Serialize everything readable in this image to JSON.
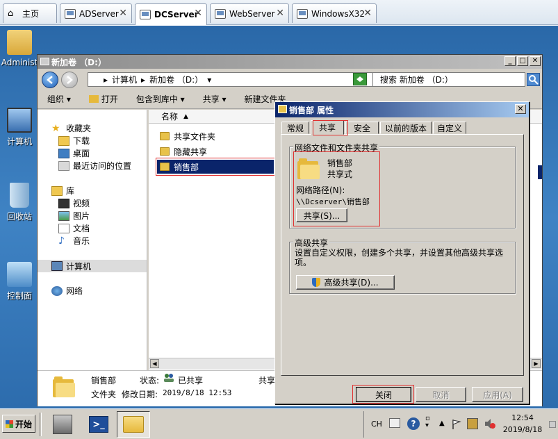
{
  "vm_tabs": [
    {
      "label": "主页",
      "icon": "home-icon"
    },
    {
      "label": "ADServer",
      "icon": "vm-icon"
    },
    {
      "label": "DCServer",
      "icon": "vm-icon",
      "active": true
    },
    {
      "label": "WebServer",
      "icon": "vm-icon"
    },
    {
      "label": "WindowsX32",
      "icon": "vm-icon"
    }
  ],
  "desktop_icons": [
    {
      "label": "Administ"
    },
    {
      "label": "计算机"
    },
    {
      "label": "回收站"
    },
    {
      "label": "控制面"
    }
  ],
  "explorer": {
    "title": "新加卷 （D:）",
    "address": {
      "crumb1": "计算机",
      "crumb2": "新加卷 （D:）"
    },
    "search_placeholder": "搜索 新加卷 （D:）",
    "commands": {
      "organize": "组织 ▾",
      "open": "打开",
      "include_library": "包含到库中 ▾",
      "share": "共享 ▾",
      "new_folder": "新建文件夹"
    },
    "nav": {
      "favorites": "收藏夹",
      "downloads": "下载",
      "desktop": "桌面",
      "recent": "最近访问的位置",
      "libraries": "库",
      "videos": "视频",
      "pictures": "图片",
      "documents": "文档",
      "music": "音乐",
      "computer": "计算机",
      "network": "网络"
    },
    "column_name": "名称",
    "files": [
      {
        "name": "共享文件夹"
      },
      {
        "name": "隐藏共享"
      },
      {
        "name": "销售部",
        "selected": true
      }
    ],
    "details": {
      "name": "销售部",
      "type": "文件夹",
      "status_label": "状态:",
      "status_value": "已共享",
      "modified_label": "修改日期:",
      "modified_value": "2019/8/18 12:53",
      "share_label": "共享"
    }
  },
  "dialog": {
    "title": "销售部 属性",
    "tabs": [
      {
        "label": "常规"
      },
      {
        "label": "共享",
        "active": true
      },
      {
        "label": "安全"
      },
      {
        "label": "以前的版本"
      },
      {
        "label": "自定义"
      }
    ],
    "network_share": {
      "group_label": "网络文件和文件夹共享",
      "folder_name": "销售部",
      "folder_state": "共享式",
      "path_label": "网络路径(N):",
      "path_value": "\\\\Dcserver\\销售部",
      "share_button": "共享(S)..."
    },
    "advanced_share": {
      "group_label": "高级共享",
      "description": "设置自定义权限，创建多个共享，并设置其他高级共享选项。",
      "button": "高级共享(D)..."
    },
    "buttons": {
      "close": "关闭",
      "cancel": "取消",
      "apply": "应用(A)"
    }
  },
  "taskbar": {
    "start": "开始",
    "tray": {
      "lang": "CH",
      "time": "12:54",
      "date": "2019/8/18"
    }
  }
}
